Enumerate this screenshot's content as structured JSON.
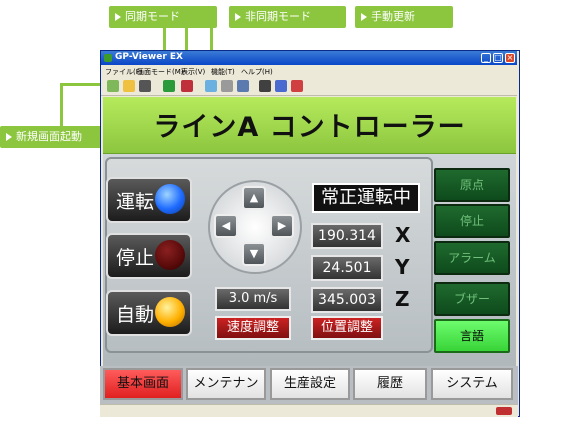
{
  "callouts": {
    "sync_mode": "同期モード",
    "async_mode": "非同期モード",
    "manual_update": "手動更新",
    "new_screen": "新規画面起動"
  },
  "window": {
    "title": "GP-Viewer EX",
    "menu": [
      "ファイル(F)",
      "画面モード(M)",
      "表示(V)",
      "機能(T)",
      "ヘルプ(H)"
    ]
  },
  "banner": {
    "title": "ラインA コントローラー"
  },
  "operation": {
    "run": {
      "label": "運転",
      "lamp_color": "#1e6bff"
    },
    "stop": {
      "label": "停止",
      "lamp_color": "#5a0a0a"
    },
    "auto": {
      "label": "自動",
      "lamp_color": "#ffb000"
    }
  },
  "status_text": "常正運転中",
  "coordinates": {
    "x_value": "190.314",
    "x_label": "X",
    "y_value": "24.501",
    "y_label": "Y",
    "z_value": "345.003",
    "z_label": "Z"
  },
  "speed": {
    "value": "3.0 m/s",
    "adjust_label": "速度調整"
  },
  "position_adjust_label": "位置調整",
  "side_buttons": [
    "原点",
    "停止",
    "アラーム",
    "ブザー",
    "言語"
  ],
  "tabs": [
    "基本画面",
    "メンテナンス",
    "生産設定",
    "履歴",
    "システム"
  ],
  "colors": {
    "accent_green": "#8cc63f",
    "active_tab": "#e02020",
    "lamp_run": "#1e6bff",
    "lamp_auto": "#ffb000"
  }
}
